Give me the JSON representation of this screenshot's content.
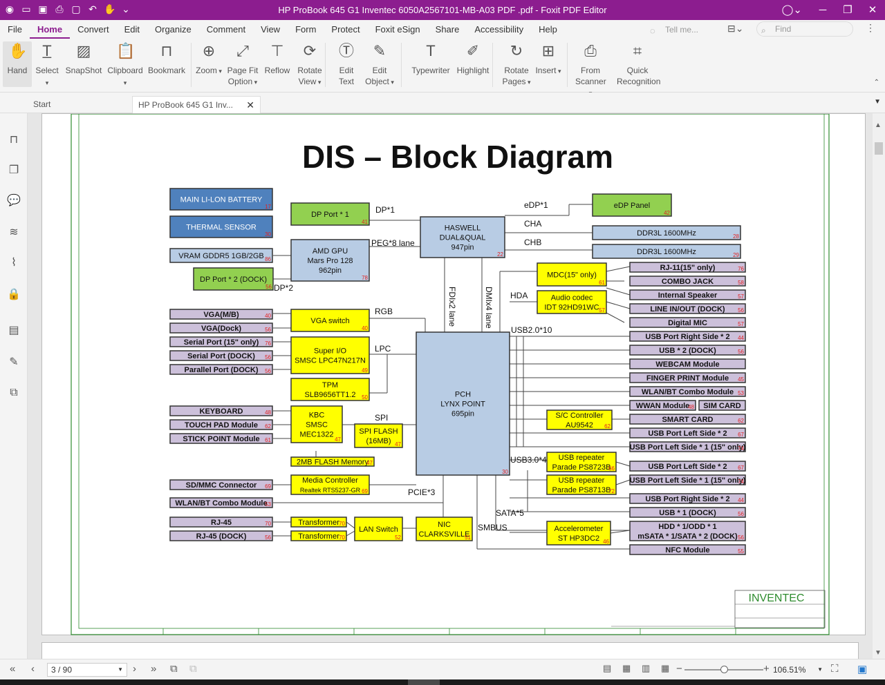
{
  "window": {
    "title": "HP ProBook 645 G1 Inventec 6050A2567101-MB-A03 PDF .pdf - Foxit PDF Editor"
  },
  "menu": [
    "File",
    "Home",
    "Convert",
    "Edit",
    "Organize",
    "Comment",
    "View",
    "Form",
    "Protect",
    "Foxit eSign",
    "Share",
    "Accessibility",
    "Help"
  ],
  "menu_active": "Home",
  "tellme": {
    "placeholder": "Tell me..."
  },
  "find": {
    "placeholder": "Find"
  },
  "ribbon": [
    {
      "label": "Hand",
      "icon": "hand-icon"
    },
    {
      "label": "Select",
      "icon": "select-icon"
    },
    {
      "label": "SnapShot",
      "icon": "snapshot-icon"
    },
    {
      "label": "Clipboard",
      "icon": "clipboard-icon"
    },
    {
      "label": "Bookmark",
      "icon": "bookmark-icon"
    },
    {
      "label": "Zoom",
      "icon": "zoom-icon"
    },
    {
      "label": "Page Fit Option",
      "icon": "page-fit-icon"
    },
    {
      "label": "Reflow",
      "icon": "reflow-icon"
    },
    {
      "label": "Rotate View",
      "icon": "rotate-view-icon"
    },
    {
      "label": "Edit Text",
      "icon": "edit-text-icon"
    },
    {
      "label": "Edit Object",
      "icon": "edit-object-icon"
    },
    {
      "label": "Typewriter",
      "icon": "typewriter-icon"
    },
    {
      "label": "Highlight",
      "icon": "highlight-icon"
    },
    {
      "label": "Rotate Pages",
      "icon": "rotate-pages-icon"
    },
    {
      "label": "Insert",
      "icon": "insert-icon"
    },
    {
      "label": "From Scanner",
      "icon": "scanner-icon"
    },
    {
      "label": "Quick Recognition",
      "icon": "ocr-icon"
    }
  ],
  "tabs": [
    {
      "label": "Start"
    },
    {
      "label": "HP ProBook 645 G1 Inv..."
    }
  ],
  "status": {
    "page": "3 / 90",
    "zoom": "106.51%"
  },
  "diagram": {
    "title": "DIS – Block Diagram",
    "company": "INVENTEC",
    "labels": {
      "dp1": "DP*1",
      "peg": "PEG*8 lane",
      "dp2": "DP*2",
      "edp1": "eDP*1",
      "cha": "CHA",
      "chb": "CHB",
      "fdi": "FDIx2 lane",
      "dmi": "DMIx4 lane",
      "hda": "HDA",
      "usb2": "USB2.0*10",
      "rgb": "RGB",
      "lpc": "LPC",
      "spi": "SPI",
      "usb3": "USB3.0*4",
      "pcie": "PCIE*3",
      "sata": "SATA*5",
      "smbus": "SMBUS"
    },
    "blocks": {
      "battery": "MAIN LI-LON BATTERY",
      "thermal": "THERMAL SENSOR",
      "vram": "VRAM GDDR5 1GB/2GB",
      "dpport1": "DP Port * 1",
      "gpu": "AMD GPU\nMars Pro 128\n962pin",
      "dpport2": "DP Port * 2 (DOCK)",
      "haswell": "HASWELL\nDUAL&QUAL\n947pin",
      "edp": "eDP  Panel",
      "ddr1": "DDR3L 1600MHz",
      "ddr2": "DDR3L 1600MHz",
      "mdc": "MDC(15\" only)",
      "audio": "Audio codec\nIDT 92HD91WC",
      "vgamb": "VGA(M/B)",
      "vgadock": "VGA(Dock)",
      "serial15": "Serial Port (15\" only)",
      "serialdock": "Serial Port (DOCK)",
      "paralleldock": "Parallel Port (DOCK)",
      "vgaswitch": "VGA switch",
      "superio": "Super I/O\nSMSC LPC47N217N",
      "tpm": "TPM\nSLB9656TT1.2",
      "pch": "PCH\nLYNX POINT\n695pin",
      "keyboard": "KEYBOARD",
      "touchpad": "TOUCH PAD Module",
      "stickpoint": "STICK POINT Module",
      "kbc": "KBC\nSMSC\nMEC1322",
      "spiflash": "SPI FLASH\n(16MB)",
      "flash2m": "2MB FLASH Memory",
      "sdmmc": "SD/MMC Connector",
      "mediactrl": "Media Controller\nRealtek RTS5237-GR",
      "wlanbt": "WLAN/BT Combo Module",
      "rj45": "RJ-45",
      "rj45dock": "RJ-45 (DOCK)",
      "transformer1": "Transformer",
      "transformer2": "Transformer",
      "lanswitch": "LAN Switch",
      "nic": "NIC\nCLARKSVILLE",
      "rj11": "RJ-11(15\" only)",
      "combojack": "COMBO JACK",
      "speaker": "Internal Speaker",
      "linein": "LINE IN/OUT (DOCK)",
      "dmic": "Digital MIC",
      "usbr2": "USB Port Right Side * 2",
      "usb2dock": "USB * 2 (DOCK)",
      "webcam": "WEBCAM Module",
      "finger": "FINGER PRINT Module",
      "wlanbt2": "WLAN/BT Combo Module",
      "wwan": "WWAN Module",
      "sim": "SIM CARD",
      "smartcard": "SMART CARD",
      "usbl2": "USB Port Left Side * 2",
      "usbl1": "USB Port Left Side * 1 (15\" only)",
      "scctrl": "S/C Controller\nAU9542",
      "usbrep1": "USB repeater\nParade PS8723B",
      "usbrep2": "USB repeater\nParade PS8713B",
      "usbl2b": "USB Port Left Side * 2",
      "usbl1b": "USB Port Left Side * 1 (15\" only)",
      "usbr2b": "USB Port Right Side * 2",
      "usb1dock": "USB * 1 (DOCK)",
      "hdd": "HDD * 1/ODD * 1\nmSATA * 1/SATA * 2 (DOCK)",
      "accel": "Accelerometer\nST HP3DC2",
      "nfc": "NFC Module"
    },
    "refs": {
      "battery": "17",
      "thermal": "30",
      "vram": "86",
      "dpport1": "41",
      "gpu": "78",
      "dpport2": "56",
      "haswell": "22",
      "edp": "42",
      "ddr1": "28",
      "ddr2": "29",
      "mdc": "61",
      "audio": "57",
      "vgamb": "40",
      "vgadock": "56",
      "serial15": "76",
      "serialdock": "56",
      "paralleldock": "56",
      "vgaswitch": "40",
      "superio": "49",
      "tpm": "50",
      "pch": "30",
      "keyboard": "48",
      "touchpad": "62",
      "stickpoint": "61",
      "kbc": "47",
      "spiflash": "47",
      "flash2m": "47",
      "sdmmc": "69",
      "mediactrl": "69",
      "wlanbt": "53",
      "rj45": "70",
      "rj45dock": "56",
      "transformer1": "70",
      "transformer2": "70",
      "lanswitch": "52",
      "nic": "51",
      "rj11": "76",
      "combojack": "58",
      "speaker": "57",
      "linein": "56",
      "dmic": "57",
      "usbr2": "44",
      "usb2dock": "56",
      "finger": "45",
      "wlanbt2": "53",
      "wwan": "48",
      "smartcard": "62",
      "usbl2": "67",
      "usbl1": "74",
      "scctrl": "62",
      "usbrep1": "66",
      "usbrep2": "72",
      "usbl2b": "67",
      "usbl1b": "74",
      "usbr2b": "44",
      "usb1dock": "56",
      "hdd": "56",
      "accel": "46",
      "nfc": "55"
    },
    "colors": {
      "blue": "#b8cce4",
      "deepblue": "#4f81bd",
      "green": "#92d050",
      "yellow": "#ffff00",
      "lavender": "#ccc0da",
      "red": "#e02020",
      "border": "#333333",
      "frame": "#2e8b2e"
    }
  }
}
